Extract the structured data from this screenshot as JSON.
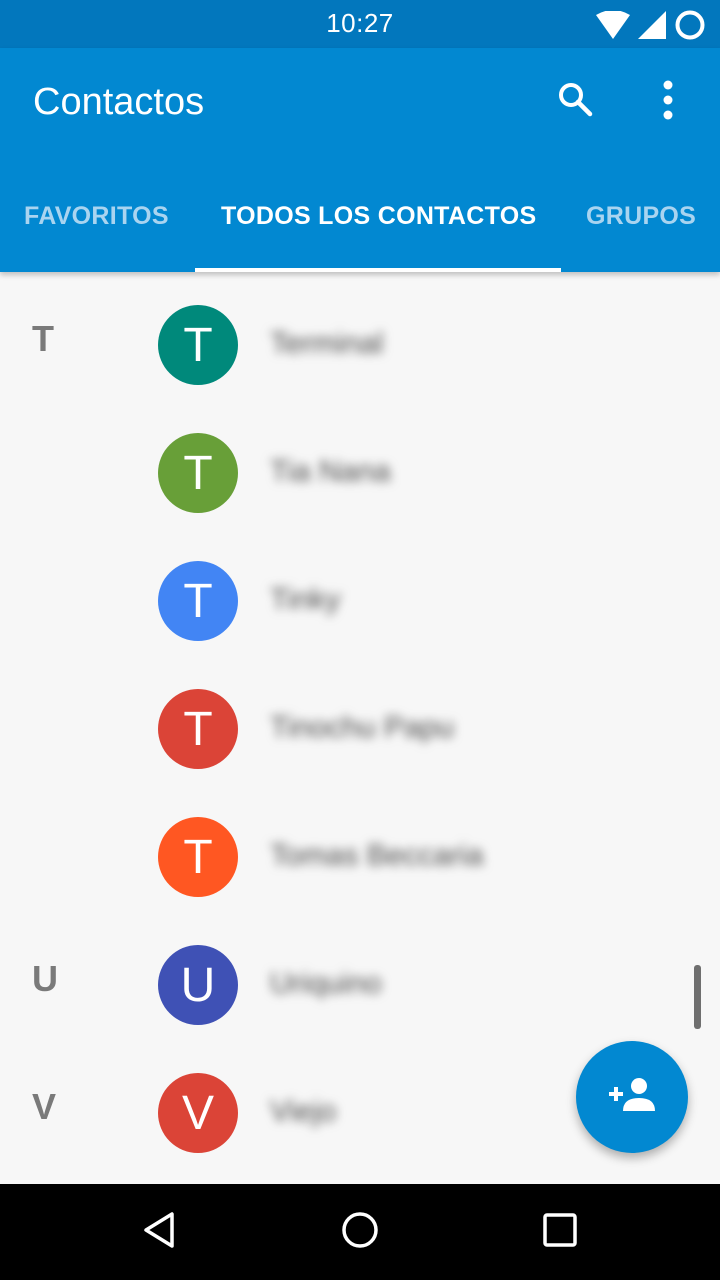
{
  "status_bar": {
    "time": "10:27",
    "icons": [
      "wifi-icon",
      "cell-signal-icon",
      "circle-status-icon"
    ]
  },
  "app_bar": {
    "title": "Contactos",
    "actions": [
      "search-icon",
      "more-vert-icon"
    ]
  },
  "tabs": [
    {
      "label": "FAVORITOS",
      "active": false
    },
    {
      "label": "TODOS LOS CONTACTOS",
      "active": true
    },
    {
      "label": "GRUPOS",
      "active": false
    }
  ],
  "contacts": [
    {
      "section": "T",
      "initial": "T",
      "color": "#00897b",
      "name": "Terminal"
    },
    {
      "section": "",
      "initial": "T",
      "color": "#689f38",
      "name": "Tia Nana"
    },
    {
      "section": "",
      "initial": "T",
      "color": "#4285f4",
      "name": "Tinky"
    },
    {
      "section": "",
      "initial": "T",
      "color": "#db4437",
      "name": "Tinochu Papu"
    },
    {
      "section": "",
      "initial": "T",
      "color": "#ff5722",
      "name": "Tomas Beccaria"
    },
    {
      "section": "U",
      "initial": "U",
      "color": "#3f51b5",
      "name": "Uriquino"
    },
    {
      "section": "V",
      "initial": "V",
      "color": "#db4437",
      "name": "Viejo"
    }
  ],
  "fab": {
    "icon": "add-person-icon"
  },
  "nav_bar": {
    "icons": [
      "back-icon",
      "home-icon",
      "recents-icon"
    ]
  },
  "colors": {
    "status_bar": "#0277bd",
    "app_bar": "#0288d1",
    "tab_inactive": "#a9d4f0",
    "background": "#f7f7f7",
    "fab": "#0288d1"
  }
}
